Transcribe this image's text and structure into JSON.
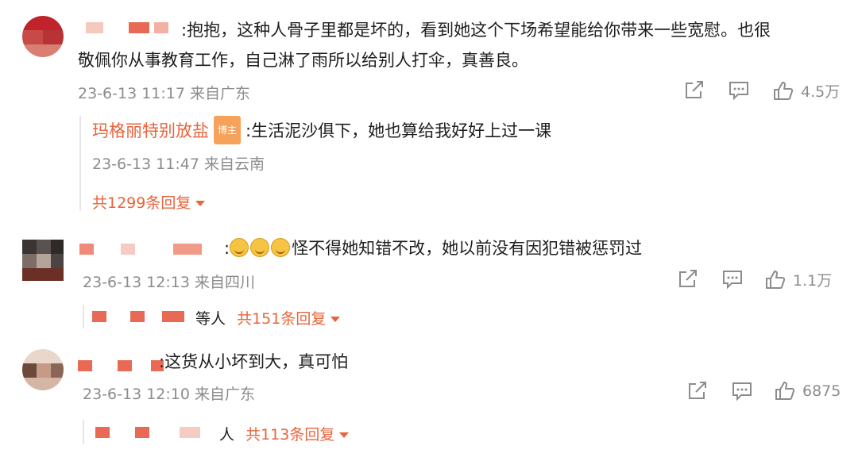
{
  "comments": [
    {
      "text_line1": ":抱抱，这种人骨子里都是坏的，看到她这个下场希望能给你带来一些宽慰。也很",
      "text_line2": "敬佩你从事教育工作，自己淋了雨所以给别人打伞，真善良。",
      "time": "23-6-13 11:17 来自广东",
      "likes": "4.5万",
      "reply": {
        "author": "玛格丽特别放盐",
        "badge": "博主",
        "text": ":生活泥沙俱下，她也算给我好好上过一课",
        "time": "23-6-13 11:47 来自云南",
        "more": "共1299条回复"
      }
    },
    {
      "text": "怪不得她知错不改，她以前没有因犯错被惩罚过",
      "emoji_count": 3,
      "time": "23-6-13 12:13 来自四川",
      "likes": "1.1万",
      "replies_suffix": "等人",
      "more": "共151条回复"
    },
    {
      "text": ":这货从小坏到大，真可怕",
      "time": "23-6-13 12:10 来自广东",
      "likes": "6875",
      "replies_suffix": "等人",
      "replies_suffix_visible": "人",
      "more": "共113条回复"
    }
  ],
  "icons": {
    "share": "share-icon",
    "comment": "comment-icon",
    "like": "thumbs-up-icon"
  },
  "colors": {
    "accent": "#e8643c",
    "muted": "#8c8c8c",
    "text": "#1e1e1e"
  }
}
